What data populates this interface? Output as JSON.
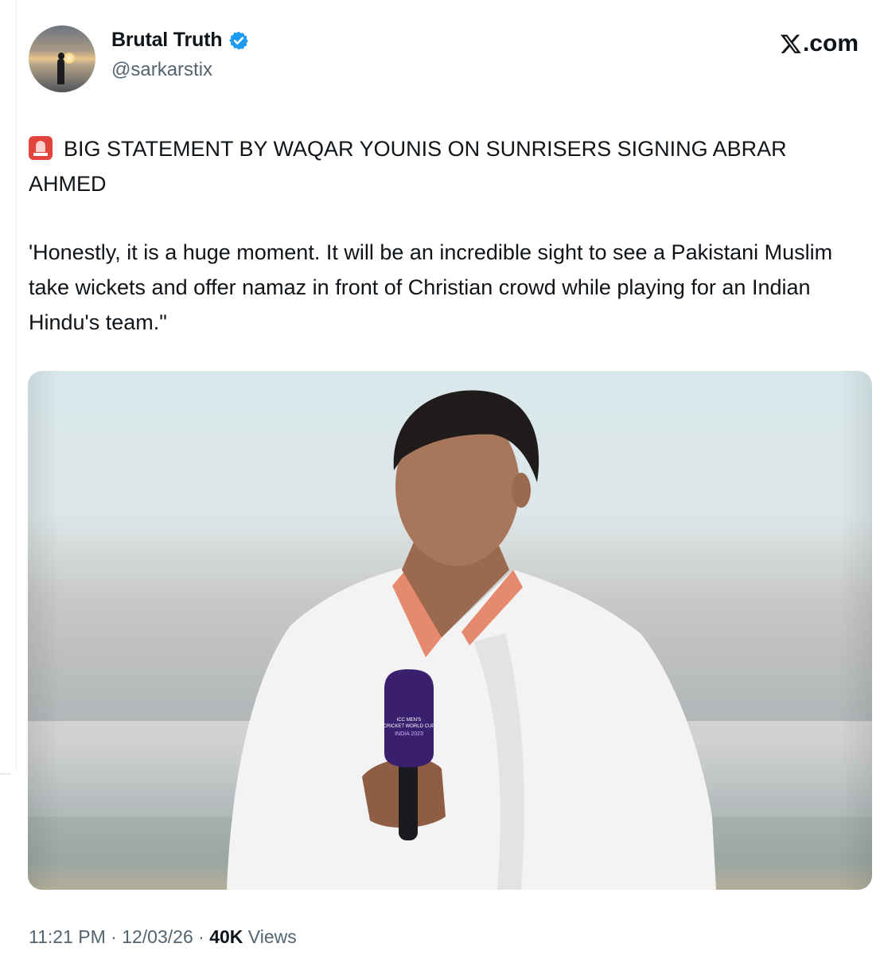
{
  "author": {
    "display_name": "Brutal Truth",
    "handle": "@sarkarstix",
    "verified_icon": "verified-badge-icon",
    "avatar_icon": "profile-avatar"
  },
  "brand": {
    "icon": "x-logo-icon",
    "label": ".com"
  },
  "tweet": {
    "headline": "BIG STATEMENT BY WAQAR YOUNIS ON SUNRISERS SIGNING ABRAR AHMED",
    "headline_icon": "police-siren-emoji",
    "quote": "'Honestly, it is a huge moment. It will be an incredible sight to see a Pakistani Muslim take wickets and offer namaz in front of Christian crowd while playing for an Indian Hindu's team.\""
  },
  "media": {
    "mic_text_line1": "ICC MEN'S",
    "mic_text_line2": "CRICKET WORLD CUP",
    "mic_text_line3": "INDIA 2023"
  },
  "meta": {
    "time": "11:21 PM",
    "separator": " · ",
    "date": "12/03/26",
    "views_count": "40K",
    "views_label": " Views"
  },
  "colors": {
    "verified": "#1d9bf0",
    "secondary_text": "#536471",
    "primary_text": "#0f1419"
  }
}
